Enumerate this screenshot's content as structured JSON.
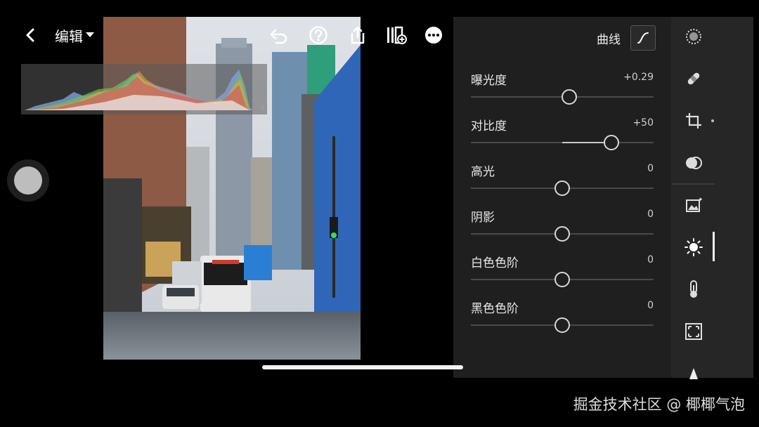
{
  "header": {
    "title": "编辑",
    "icons": [
      "back-icon",
      "undo-icon",
      "help-icon",
      "share-icon",
      "presets-icon",
      "more-icon"
    ]
  },
  "panel": {
    "section_label": "曲线",
    "sliders": [
      {
        "label": "曝光度",
        "value": "+0.29",
        "position": 0.54
      },
      {
        "label": "对比度",
        "value": "+50",
        "position": 0.77
      },
      {
        "label": "高光",
        "value": "0",
        "position": 0.5
      },
      {
        "label": "阴影",
        "value": "0",
        "position": 0.5
      },
      {
        "label": "白色色阶",
        "value": "0",
        "position": 0.5
      },
      {
        "label": "黑色色阶",
        "value": "0",
        "position": 0.5
      }
    ]
  },
  "tools": [
    "selective-edit-icon",
    "healing-icon",
    "crop-icon",
    "masking-icon",
    "presets-image-icon",
    "light-icon",
    "color-temperature-icon",
    "vignette-icon",
    "triangle-icon"
  ],
  "watermark": "掘金技术社区 @ 椰椰气泡",
  "colors": {
    "panel_bg": "#1f1f1f",
    "rail_bg": "#262626",
    "accent": "#eeeeee"
  }
}
